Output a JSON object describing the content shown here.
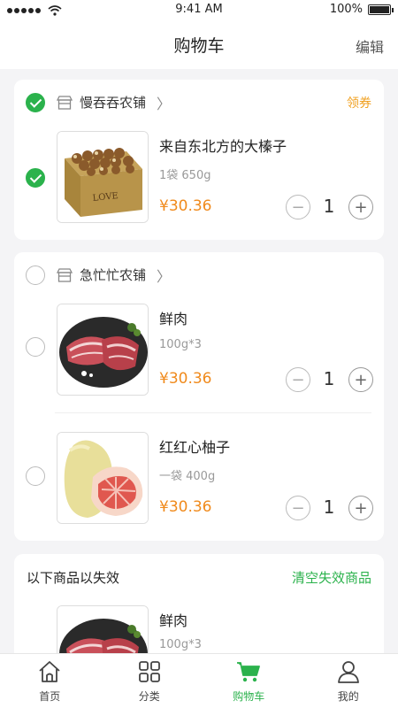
{
  "status": {
    "time": "9:41 AM",
    "battery": "100%"
  },
  "nav": {
    "title": "购物车",
    "edit_label": "编辑"
  },
  "shops": [
    {
      "name": "慢吞吞农铺",
      "coupon_label": "领券",
      "checked": true,
      "items": [
        {
          "name": "来自东北方的大榛子",
          "spec": "1袋 650g",
          "price": "¥30.36",
          "qty": "1",
          "checked": true,
          "image": "hazelnut-box"
        }
      ]
    },
    {
      "name": "急忙忙农铺",
      "checked": false,
      "items": [
        {
          "name": "鲜肉",
          "spec": "100g*3",
          "price": "¥30.36",
          "qty": "1",
          "checked": false,
          "image": "fresh-meat"
        },
        {
          "name": "红红心柚子",
          "spec": "一袋 400g",
          "price": "¥30.36",
          "qty": "1",
          "checked": false,
          "image": "pomelo"
        }
      ]
    }
  ],
  "invalid": {
    "title": "以下商品以失效",
    "clear_label": "清空失效商品",
    "items": [
      {
        "name": "鲜肉",
        "spec": "100g*3",
        "image": "fresh-meat"
      }
    ]
  },
  "tabs": [
    {
      "label": "首页",
      "icon": "home-icon",
      "active": false
    },
    {
      "label": "分类",
      "icon": "grid-icon",
      "active": false
    },
    {
      "label": "购物车",
      "icon": "cart-icon",
      "active": true
    },
    {
      "label": "我的",
      "icon": "user-icon",
      "active": false
    }
  ],
  "colors": {
    "accent": "#2bb24c",
    "price": "#f08a1c",
    "coupon": "#f0a020",
    "background": "#f4f4f6"
  }
}
